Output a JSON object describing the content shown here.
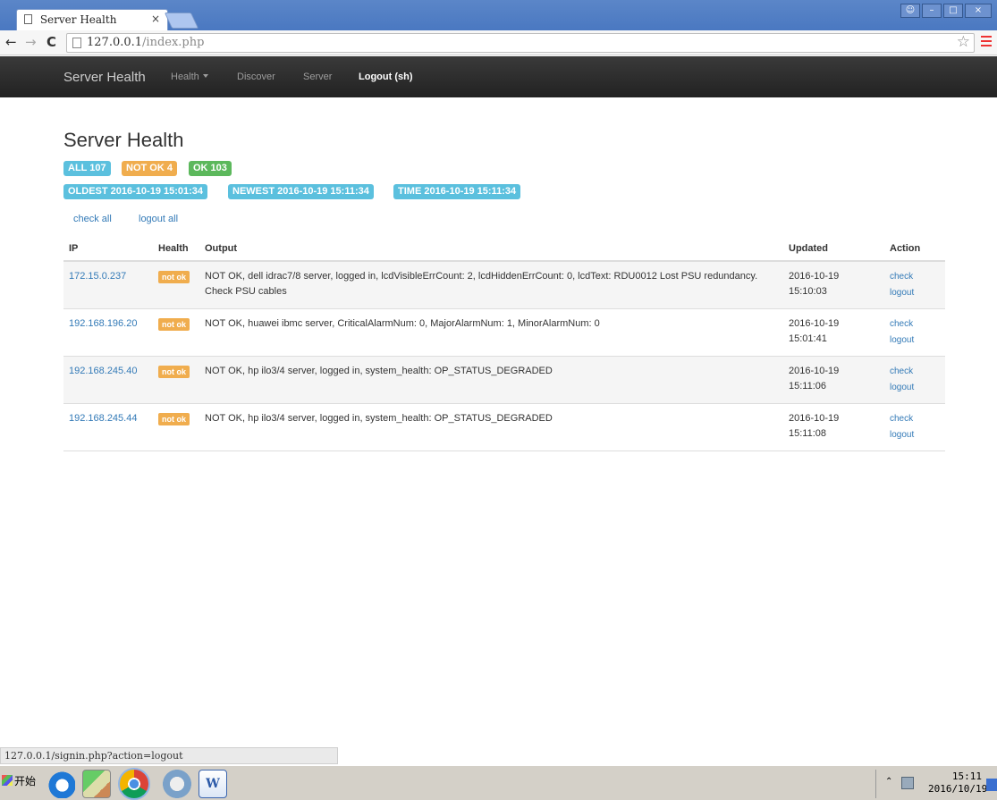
{
  "browser": {
    "tab_title": "Server Health",
    "tab_close": "×",
    "url_host": "127.0.0.1",
    "url_path": "/index.php",
    "status_url": "127.0.0.1/signin.php?action=logout"
  },
  "navbar": {
    "brand": "Server Health",
    "items": [
      "Health",
      "Discover",
      "Server",
      "Logout (sh)"
    ]
  },
  "page": {
    "title": "Server Health",
    "badges_row1": [
      "ALL 107",
      "NOT OK 4",
      "OK 103"
    ],
    "badges_row2": [
      "OLDEST 2016-10-19 15:01:34",
      "NEWEST 2016-10-19 15:11:34",
      "TIME 2016-10-19 15:11:34"
    ],
    "check_all": "check all",
    "logout_all": "logout all"
  },
  "table": {
    "headers": [
      "IP",
      "Health",
      "Output",
      "Updated",
      "Action"
    ],
    "rows": [
      {
        "ip": "172.15.0.237",
        "health": "not ok",
        "output": "NOT OK, dell idrac7/8 server, logged in, lcdVisibleErrCount: 2, lcdHiddenErrCount: 0, lcdText: RDU0012 Lost PSU redundancy. Check PSU cables",
        "date": "2016-10-19",
        "time": "15:10:03",
        "check": "check",
        "logout": "logout"
      },
      {
        "ip": "192.168.196.20",
        "health": "not ok",
        "output": "NOT OK, huawei ibmc server, CriticalAlarmNum: 0, MajorAlarmNum: 1, MinorAlarmNum: 0",
        "date": "2016-10-19",
        "time": "15:01:41",
        "check": "check",
        "logout": "logout"
      },
      {
        "ip": "192.168.245.40",
        "health": "not ok",
        "output": "NOT OK, hp ilo3/4 server, logged in, system_health: OP_STATUS_DEGRADED",
        "date": "2016-10-19",
        "time": "15:11:06",
        "check": "check",
        "logout": "logout"
      },
      {
        "ip": "192.168.245.44",
        "health": "not ok",
        "output": "NOT OK, hp ilo3/4 server, logged in, system_health: OP_STATUS_DEGRADED",
        "date": "2016-10-19",
        "time": "15:11:08",
        "check": "check",
        "logout": "logout"
      }
    ]
  },
  "taskbar": {
    "start_label": "开始",
    "clock_time": "15:11",
    "clock_date": "2016/10/19",
    "icons": [
      "ie-icon",
      "paint-icon",
      "chrome-icon",
      "virtualbox-icon",
      "word-icon"
    ]
  },
  "colors": {
    "info": "#5bc0de",
    "warning": "#f0ad4e",
    "success": "#5cb85c",
    "link": "#337ab7",
    "navbar": "#222222"
  }
}
